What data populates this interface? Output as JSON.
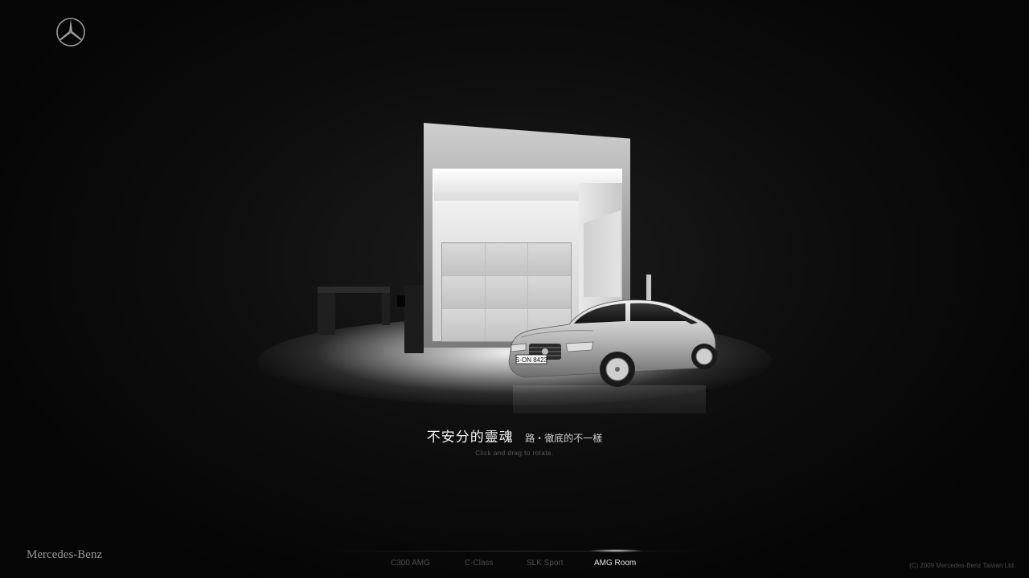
{
  "brand": {
    "logo_icon": "mercedes-star-icon",
    "wordmark": "Mercedes-Benz"
  },
  "showroom": {
    "headline": "不安分的靈魂",
    "tagline": "路・徹底的不一樣",
    "hint": "Click and drag to rotate.",
    "plate": "S·ON 8423"
  },
  "nav": {
    "items": [
      {
        "label": "C300 AMG",
        "active": false
      },
      {
        "label": "C-Class",
        "active": false
      },
      {
        "label": "SLK Sport",
        "active": false
      },
      {
        "label": "AMG Room",
        "active": true
      }
    ]
  },
  "footer": {
    "copyright": "(C) 2009 Mercedes-Benz Taiwan Ltd."
  },
  "colors": {
    "background": "#0d0d0d",
    "active_text": "#e6e6e6",
    "inactive_text": "#4e4e4e"
  }
}
